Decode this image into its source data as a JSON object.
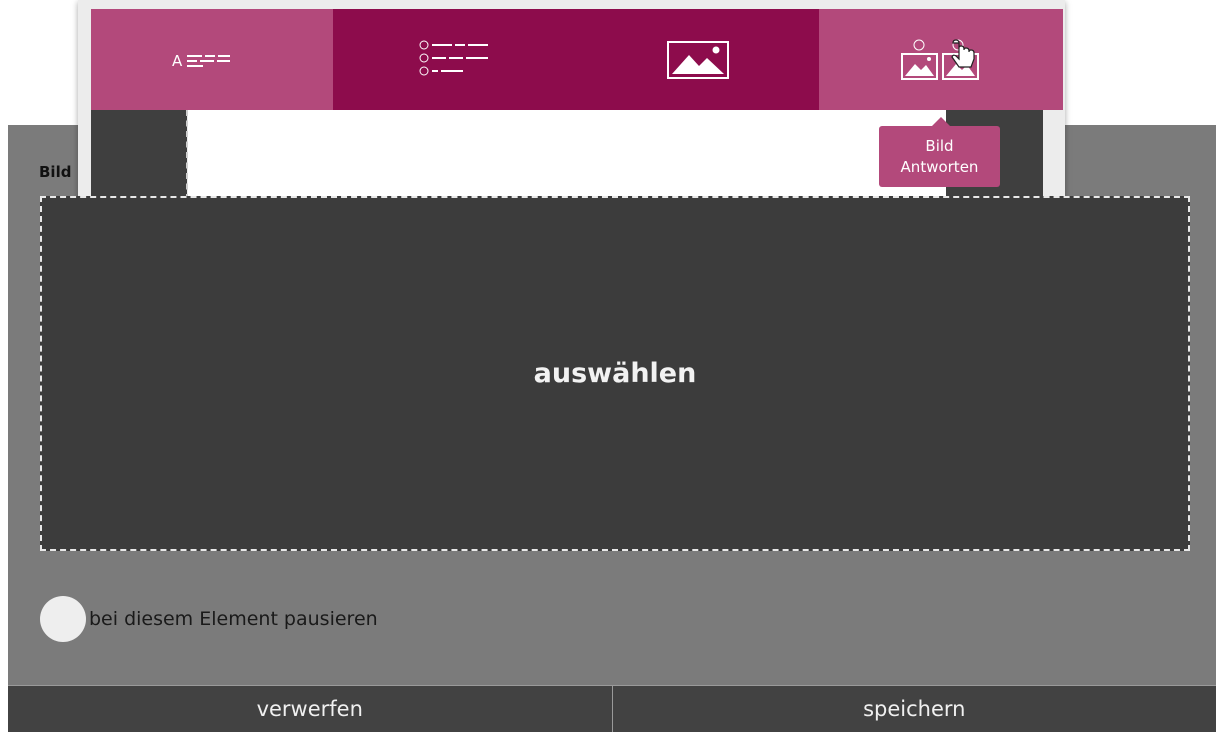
{
  "editor": {
    "section_label": "Bild",
    "dropzone_label": "auswählen",
    "pause_label": "bei diesem Element pausieren"
  },
  "tabs": [
    {
      "icon": "text-answer-icon",
      "glyph": "A",
      "active": false
    },
    {
      "icon": "multiple-choice-icon",
      "active": true
    },
    {
      "icon": "image-icon",
      "active": true
    },
    {
      "icon": "image-answers-icon",
      "active": false
    }
  ],
  "tooltip": {
    "line1": "Bild",
    "line2": "Antworten"
  },
  "footer": {
    "discard_label": "verwerfen",
    "save_label": "speichern"
  },
  "colors": {
    "tab_light": "#b3497b",
    "tab_dark": "#8d0c4c",
    "panel_gray": "#7b7b7b",
    "dropzone_bg": "#3c3c3c",
    "button_bg": "#424242"
  }
}
